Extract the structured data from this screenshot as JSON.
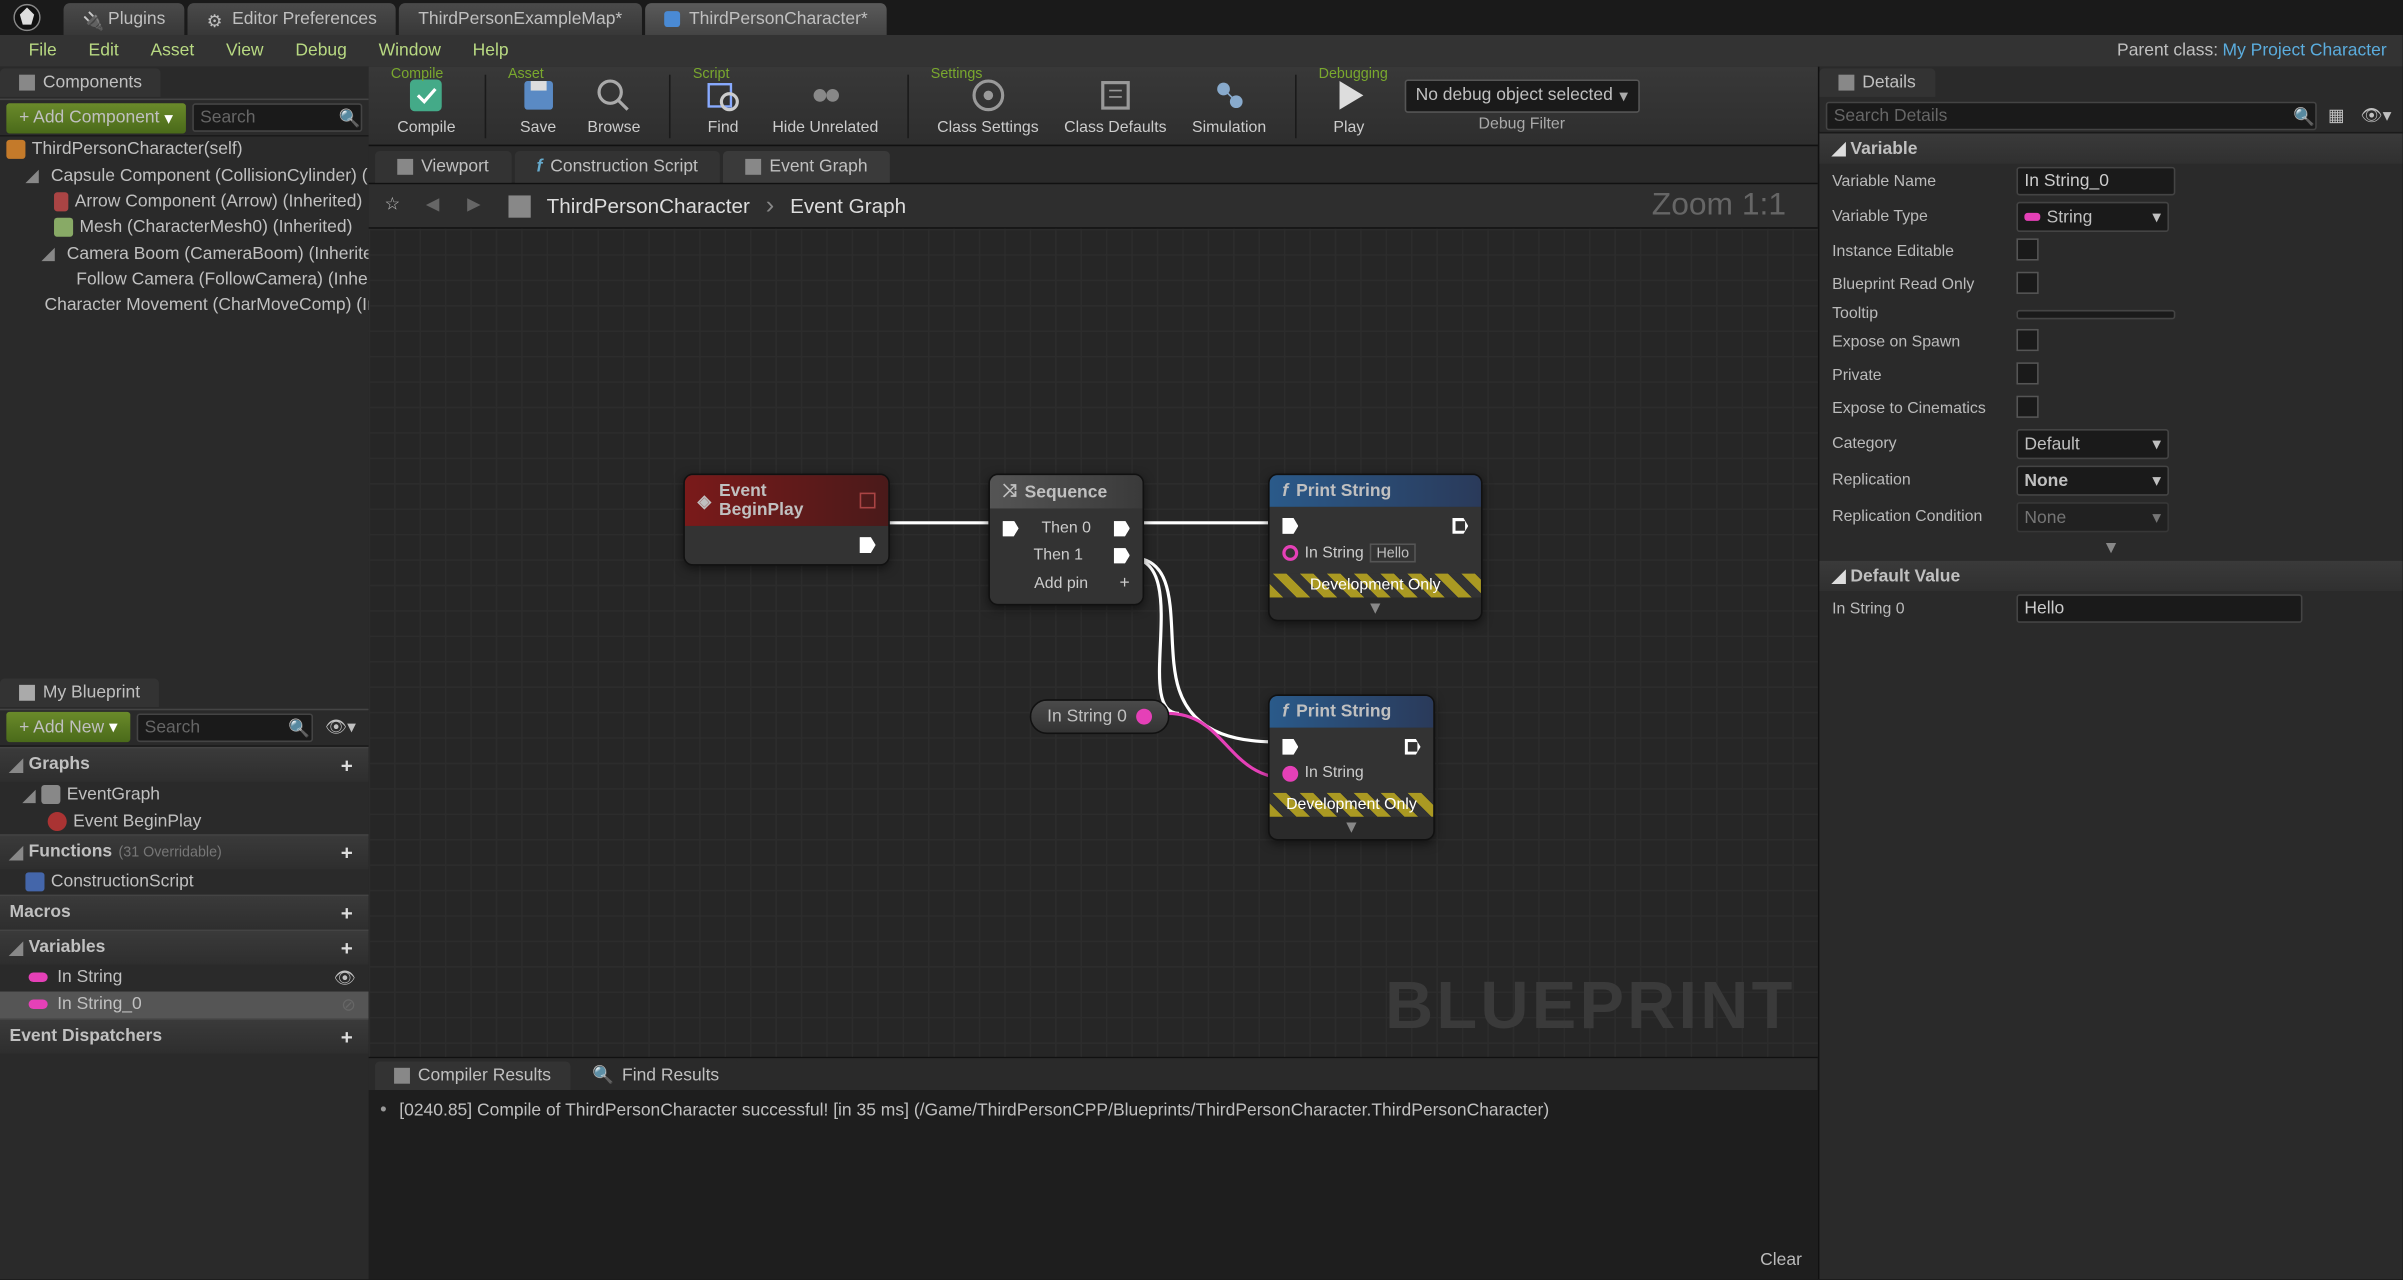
{
  "tabs": [
    {
      "label": "Plugins",
      "icon": "plug"
    },
    {
      "label": "Editor Preferences",
      "icon": "gear"
    },
    {
      "label": "ThirdPersonExampleMap*",
      "icon": "map"
    },
    {
      "label": "ThirdPersonCharacter*",
      "icon": "bp",
      "active": true
    }
  ],
  "menus": [
    "File",
    "Edit",
    "Asset",
    "View",
    "Debug",
    "Window",
    "Help"
  ],
  "parent_class": {
    "label": "Parent class:",
    "value": "My Project Character"
  },
  "components": {
    "title": "Components",
    "add_btn": "+ Add Component",
    "search_placeholder": "Search",
    "tree": [
      {
        "label": "ThirdPersonCharacter(self)",
        "indent": 0,
        "exp": false
      },
      {
        "label": "Capsule Component (CollisionCylinder) (Inherited)",
        "indent": 1,
        "exp": true
      },
      {
        "label": "Arrow Component (Arrow) (Inherited)",
        "indent": 2
      },
      {
        "label": "Mesh (CharacterMesh0) (Inherited)",
        "indent": 2
      },
      {
        "label": "Camera Boom (CameraBoom) (Inherited)",
        "indent": 2,
        "exp": true
      },
      {
        "label": "Follow Camera (FollowCamera) (Inherited)",
        "indent": 3
      },
      {
        "label": "Character Movement (CharMoveComp) (Inherited)",
        "indent": 1
      }
    ]
  },
  "myblueprint": {
    "title": "My Blueprint",
    "add_btn": "+ Add New",
    "search_placeholder": "Search",
    "sections": [
      {
        "name": "Graphs",
        "items": [
          {
            "label": "EventGraph",
            "icon": "graph",
            "exp": true
          },
          {
            "label": "Event BeginPlay",
            "icon": "event",
            "indent": 1
          }
        ]
      },
      {
        "name": "Functions",
        "note": "(31 Overridable)",
        "items": [
          {
            "label": "ConstructionScript",
            "icon": "func"
          }
        ]
      },
      {
        "name": "Macros",
        "items": []
      },
      {
        "name": "Variables",
        "items": [
          {
            "label": "In String",
            "color": "#e540b7"
          },
          {
            "label": "In String_0",
            "color": "#e540b7",
            "selected": true
          }
        ]
      },
      {
        "name": "Event Dispatchers",
        "items": []
      }
    ]
  },
  "toolbar": {
    "groups": [
      {
        "label": "Compile",
        "buttons": [
          {
            "label": "Compile",
            "icon": "compile"
          }
        ]
      },
      {
        "label": "Asset",
        "buttons": [
          {
            "label": "Save",
            "icon": "save"
          },
          {
            "label": "Browse",
            "icon": "browse"
          }
        ]
      },
      {
        "label": "Script",
        "buttons": [
          {
            "label": "Find",
            "icon": "find"
          },
          {
            "label": "Hide Unrelated",
            "icon": "hide"
          }
        ]
      },
      {
        "label": "Settings",
        "buttons": [
          {
            "label": "Class Settings",
            "icon": "class"
          },
          {
            "label": "Class Defaults",
            "icon": "defaults"
          },
          {
            "label": "Simulation",
            "icon": "sim"
          }
        ]
      },
      {
        "label": "Debugging",
        "buttons": [
          {
            "label": "Play",
            "icon": "play"
          }
        ]
      }
    ],
    "debug_selector": "No debug object selected",
    "debug_filter": "Debug Filter"
  },
  "center_tabs": [
    {
      "label": "Viewport",
      "icon": "viewport"
    },
    {
      "label": "Construction Script",
      "icon": "func"
    },
    {
      "label": "Event Graph",
      "icon": "graph",
      "active": true
    }
  ],
  "breadcrumb": {
    "root": "ThirdPersonCharacter",
    "leaf": "Event Graph"
  },
  "zoom": "Zoom 1:1",
  "watermark": "BLUEPRINT",
  "nodes": {
    "beginplay": {
      "title": "Event BeginPlay"
    },
    "sequence": {
      "title": "Sequence",
      "pins": [
        "Then 0",
        "Then 1"
      ],
      "add": "Add pin"
    },
    "print1": {
      "title": "Print String",
      "in_string_label": "In String",
      "in_string_val": "Hello",
      "dev": "Development Only"
    },
    "varnode": {
      "label": "In String 0"
    },
    "print2": {
      "title": "Print String",
      "in_string_label": "In String",
      "dev": "Development Only"
    }
  },
  "details": {
    "title": "Details",
    "search_placeholder": "Search Details",
    "variable_section": "Variable",
    "rows": [
      {
        "label": "Variable Name",
        "type": "text",
        "value": "In String_0"
      },
      {
        "label": "Variable Type",
        "type": "typedrop",
        "value": "String",
        "color": "#e540b7"
      },
      {
        "label": "Instance Editable",
        "type": "check",
        "value": false
      },
      {
        "label": "Blueprint Read Only",
        "type": "check",
        "value": false
      },
      {
        "label": "Tooltip",
        "type": "text",
        "value": ""
      },
      {
        "label": "Expose on Spawn",
        "type": "check",
        "value": false
      },
      {
        "label": "Private",
        "type": "check",
        "value": false
      },
      {
        "label": "Expose to Cinematics",
        "type": "check",
        "value": false
      },
      {
        "label": "Category",
        "type": "drop",
        "value": "Default"
      },
      {
        "label": "Replication",
        "type": "drop",
        "value": "None",
        "bold": true
      },
      {
        "label": "Replication Condition",
        "type": "drop",
        "value": "None",
        "disabled": true
      }
    ],
    "default_section": "Default Value",
    "default_rows": [
      {
        "label": "In String 0",
        "type": "text",
        "value": "Hello"
      }
    ]
  },
  "results": {
    "tabs": [
      {
        "label": "Compiler Results",
        "active": true
      },
      {
        "label": "Find Results"
      }
    ],
    "log": "[0240.85] Compile of ThirdPersonCharacter successful! [in 35 ms] (/Game/ThirdPersonCPP/Blueprints/ThirdPersonCharacter.ThirdPersonCharacter)",
    "clear": "Clear"
  }
}
